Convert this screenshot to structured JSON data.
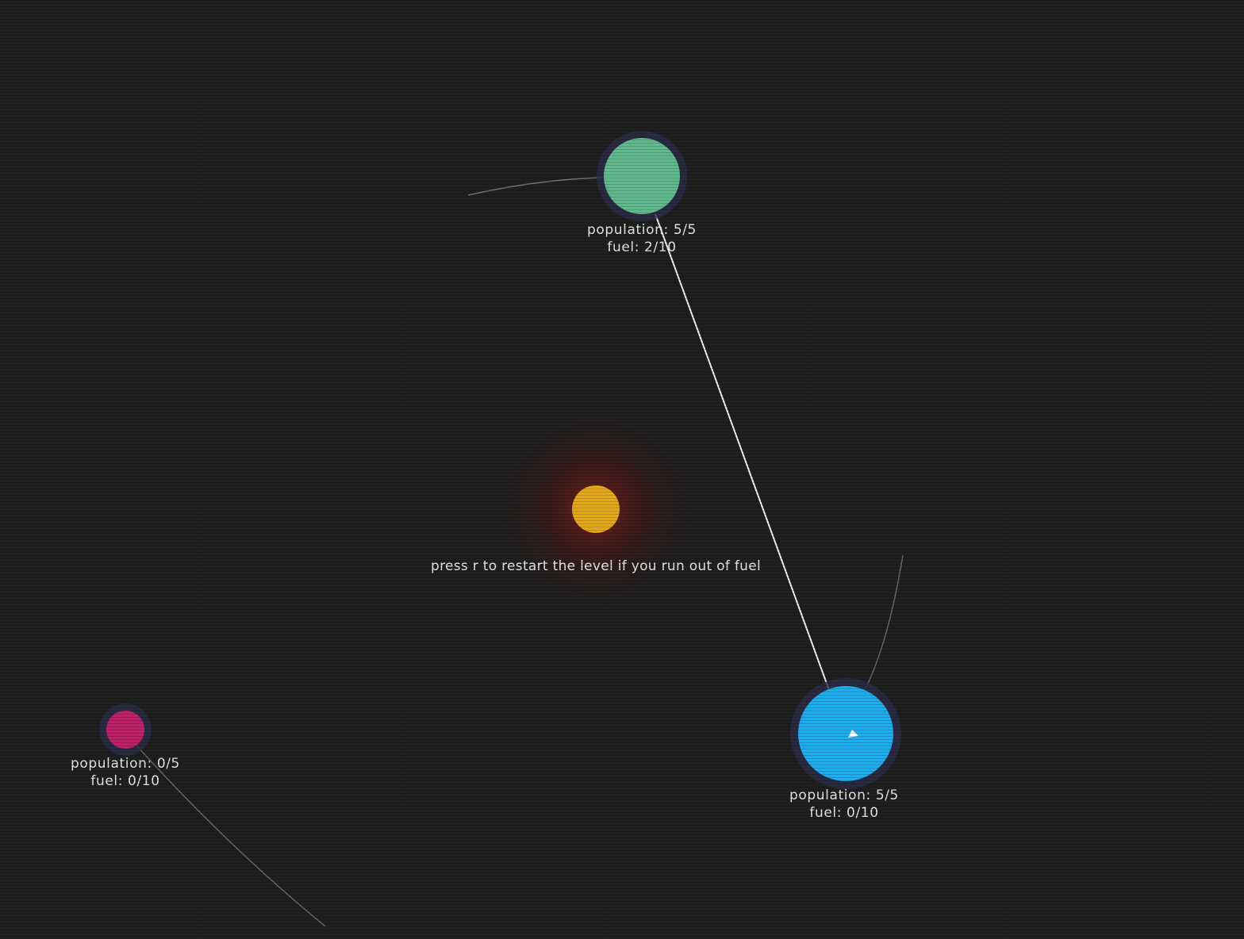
{
  "hint": "press r to restart the level if you run out of fuel",
  "colors": {
    "background": "#1f1f1f",
    "sun": "#e6a817",
    "sun_glow": "#8a1a12",
    "planet_halo": "#2a2d4a",
    "orbit_line": "#bdbdbd",
    "route_line": "#f2f2f2"
  },
  "sun": {
    "name": "sun"
  },
  "planets": [
    {
      "id": "green",
      "color": "#5dbb8c",
      "population": "population: 5/5",
      "fuel": "fuel: 2/10"
    },
    {
      "id": "blue",
      "color": "#1aaef2",
      "population": "population: 5/5",
      "fuel": "fuel: 0/10",
      "has_ship": true
    },
    {
      "id": "magenta",
      "color": "#c21f6a",
      "population": "population: 0/5",
      "fuel": "fuel: 0/10"
    }
  ],
  "icons": {
    "ship": "ship-icon"
  }
}
